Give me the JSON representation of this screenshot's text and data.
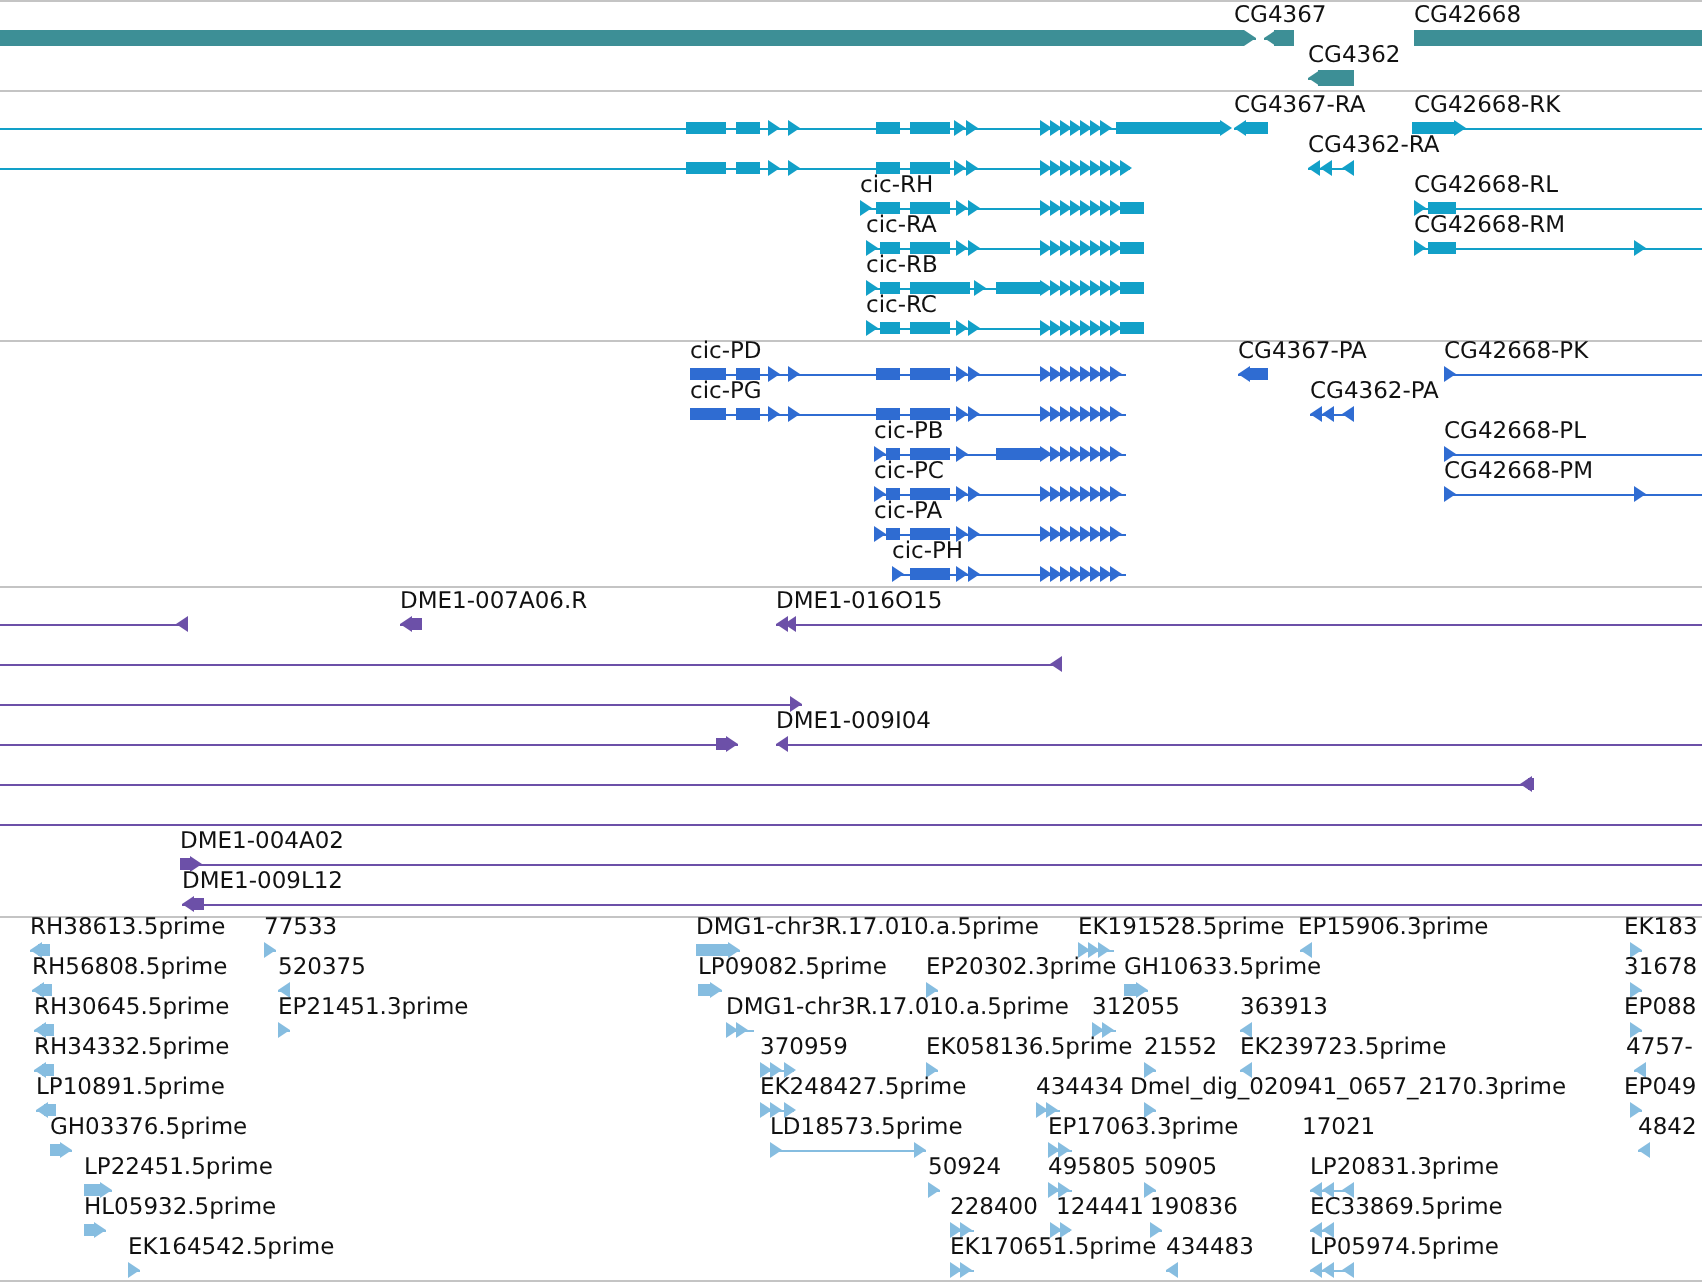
{
  "tracks": [
    {
      "kind": "gene",
      "features": [
        {
          "reverse": false
        },
        {
          "label": "CG4367",
          "reverse": true
        },
        {
          "label": "CG42668"
        },
        {
          "label": "CG4362",
          "reverse": true
        }
      ]
    },
    {
      "kind": "transcript",
      "features": [
        {
          "reverse": false
        },
        {
          "label": "CG4367-RA",
          "reverse": true
        },
        {
          "label": "CG42668-RK",
          "reverse": false
        },
        {
          "reverse": false
        },
        {
          "label": "CG4362-RA",
          "reverse": true
        },
        {
          "label": "cic-RH",
          "reverse": false
        },
        {
          "label": "CG42668-RL",
          "reverse": false
        },
        {
          "label": "cic-RA",
          "reverse": false
        },
        {
          "label": "CG42668-RM",
          "reverse": false
        },
        {
          "label": "cic-RB",
          "reverse": false
        },
        {
          "label": "cic-RC",
          "reverse": false
        }
      ]
    },
    {
      "kind": "protein",
      "features": [
        {
          "label": "cic-PD",
          "reverse": false
        },
        {
          "label": "CG4367-PA",
          "reverse": true
        },
        {
          "label": "CG42668-PK",
          "reverse": false
        },
        {
          "label": "cic-PG",
          "reverse": false
        },
        {
          "label": "CG4362-PA",
          "reverse": true
        },
        {
          "label": "cic-PB",
          "reverse": false
        },
        {
          "label": "CG42668-PL",
          "reverse": false
        },
        {
          "label": "cic-PC",
          "reverse": false
        },
        {
          "label": "CG42668-PM",
          "reverse": false
        },
        {
          "label": "cic-PA",
          "reverse": false
        },
        {
          "label": "cic-PH",
          "reverse": false
        }
      ]
    },
    {
      "kind": "clone",
      "features": [
        {
          "reverse": true
        },
        {
          "label": "DME1-007A06.R",
          "reverse": true
        },
        {
          "label": "DME1-016O15",
          "reverse": true
        },
        {
          "reverse": true
        },
        {
          "reverse": false
        },
        {
          "reverse": false
        },
        {
          "label": "DME1-009I04",
          "reverse": true
        },
        {
          "reverse": true
        },
        {
          "kind": "line"
        },
        {
          "label": "DME1-004A02",
          "reverse": false
        },
        {
          "label": "DME1-009L12",
          "reverse": true
        }
      ]
    },
    {
      "kind": "est",
      "features": [
        {
          "label": "RH38613.5prime",
          "reverse": true
        },
        {
          "label": "77533",
          "reverse": false
        },
        {
          "label": "DMG1-chr3R.17.010.a.5prime",
          "reverse": false
        },
        {
          "label": "EK191528.5prime",
          "reverse": false
        },
        {
          "label": "EP15906.3prime",
          "reverse": true
        },
        {
          "label": "EK183",
          "reverse": false
        },
        {
          "label": "RH56808.5prime",
          "reverse": true
        },
        {
          "label": "520375",
          "reverse": true
        },
        {
          "label": "LP09082.5prime",
          "reverse": false
        },
        {
          "label": "EP20302.3prime",
          "reverse": false
        },
        {
          "label": "GH10633.5prime",
          "reverse": false
        },
        {
          "label": "31678",
          "reverse": false
        },
        {
          "label": "RH30645.5prime",
          "reverse": true
        },
        {
          "label": "EP21451.3prime",
          "reverse": false
        },
        {
          "label": "DMG1-chr3R.17.010.a.5prime",
          "reverse": false
        },
        {
          "label": "312055",
          "reverse": false
        },
        {
          "label": "363913",
          "reverse": true
        },
        {
          "label": "EP088",
          "reverse": false
        },
        {
          "label": "RH34332.5prime",
          "reverse": true
        },
        {
          "label": "370959",
          "reverse": false
        },
        {
          "label": "EK058136.5prime",
          "reverse": false
        },
        {
          "label": "21552",
          "reverse": false
        },
        {
          "label": "EK239723.5prime",
          "reverse": true
        },
        {
          "label": "4757-",
          "reverse": true
        },
        {
          "label": "LP10891.5prime",
          "reverse": true
        },
        {
          "label": "EK248427.5prime",
          "reverse": false
        },
        {
          "label": "434434",
          "reverse": false
        },
        {
          "label": "Dmel_dig_020941_0657_2170.3prime",
          "reverse": false
        },
        {
          "label": "EP049",
          "reverse": false
        },
        {
          "label": "GH03376.5prime",
          "reverse": false
        },
        {
          "label": "LD18573.5prime",
          "reverse": false
        },
        {
          "label": "EP17063.3prime",
          "reverse": false
        },
        {
          "label": "17021"
        },
        {
          "label": "4842",
          "reverse": true
        },
        {
          "label": "LP22451.5prime",
          "reverse": false
        },
        {
          "label": "50924",
          "reverse": false
        },
        {
          "label": "495805",
          "reverse": false
        },
        {
          "label": "50905",
          "reverse": false
        },
        {
          "label": "LP20831.3prime",
          "reverse": true
        },
        {
          "label": "HL05932.5prime",
          "reverse": false
        },
        {
          "label": "228400",
          "reverse": false
        },
        {
          "label": "124441",
          "reverse": false
        },
        {
          "label": "190836",
          "reverse": false
        },
        {
          "label": "EC33869.5prime",
          "reverse": true
        },
        {
          "label": "EK164542.5prime",
          "reverse": false
        },
        {
          "label": "EK170651.5prime",
          "reverse": false
        },
        {
          "label": "434483",
          "reverse": true
        },
        {
          "label": "LP05974.5prime",
          "reverse": true
        }
      ]
    }
  ]
}
